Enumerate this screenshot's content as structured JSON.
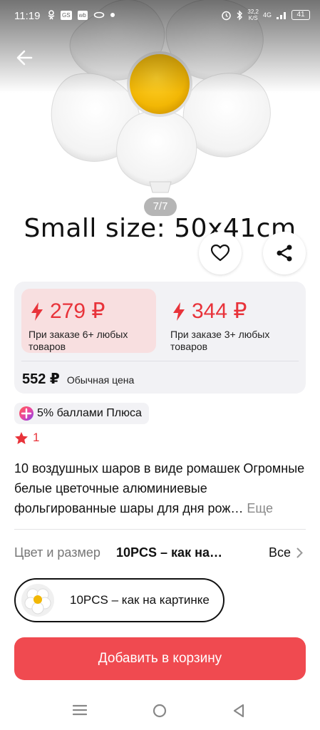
{
  "status_bar": {
    "time": "11:19",
    "icons_left": [
      "ok-icon",
      "gs",
      "wb",
      "dot"
    ],
    "left_badges": [
      "GS",
      "wb"
    ],
    "network_speed": "32,2\nK/S",
    "network_speed_top": "32,2",
    "network_speed_bottom": "K/S",
    "network_type": "4G",
    "battery": "41"
  },
  "gallery": {
    "counter": "7/7",
    "caption": "Small size: 50x41cm"
  },
  "price": {
    "tier1_value": "279 ₽",
    "tier1_note": "При заказе 6+ любых товаров",
    "tier2_value": "344 ₽",
    "tier2_note": "При заказе 3+ любых товаров",
    "regular_value": "552 ₽",
    "regular_label": "Обычная цена"
  },
  "plus": {
    "label": "5% баллами Плюса"
  },
  "rating": {
    "count": "1"
  },
  "product": {
    "title": "10 воздушных шаров в виде ромашек Огромные белые цветочные алюминиевые фольгированные шары для дня рож…",
    "more": "Еще"
  },
  "variant": {
    "label": "Цвет и размер",
    "value": "10PCS – как на…",
    "all": "Все",
    "chip_label": "10PCS – как на картинке"
  },
  "cta": {
    "label": "Добавить в корзину"
  },
  "colors": {
    "accent_red": "#e8333a",
    "cta_bg": "#f04a50",
    "tier_active_bg": "#f8dfe0",
    "card_bg": "#f2f2f5"
  }
}
